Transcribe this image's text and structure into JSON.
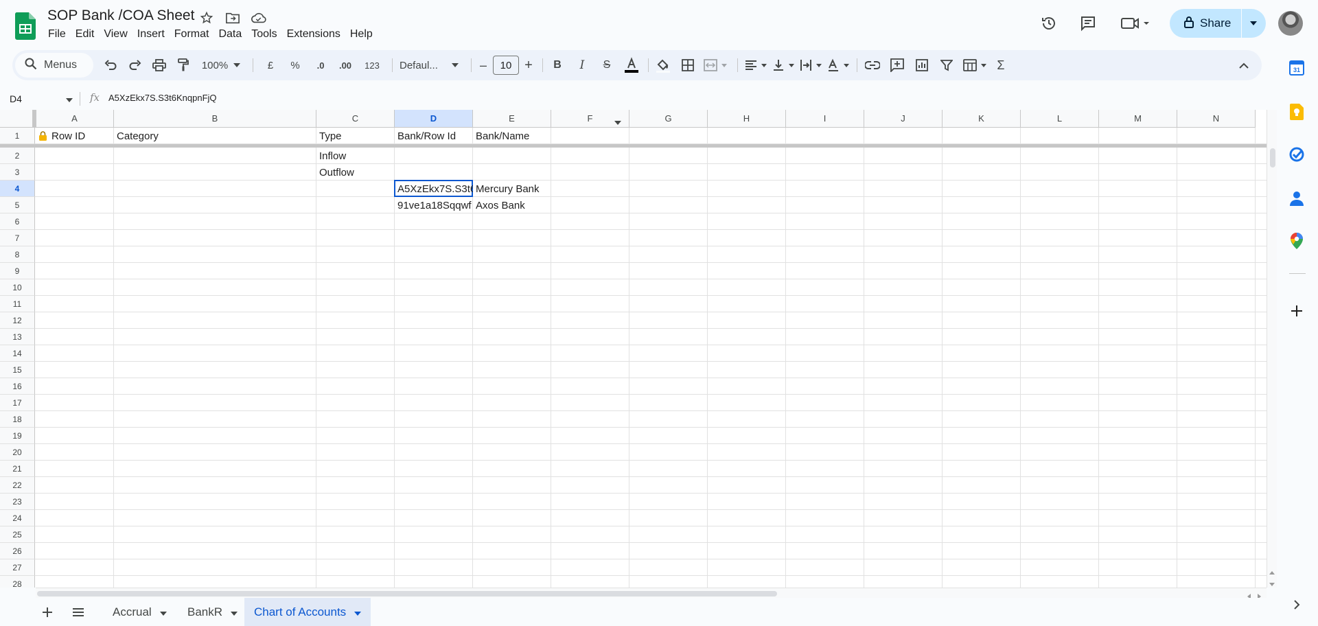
{
  "app": {
    "doc_title": "SOP Bank /COA Sheet",
    "menu": [
      "File",
      "Edit",
      "View",
      "Insert",
      "Format",
      "Data",
      "Tools",
      "Extensions",
      "Help"
    ],
    "share_label": "Share"
  },
  "toolbar": {
    "menus_label": "Menus",
    "zoom": "100%",
    "currency_symbol": "£",
    "percent_symbol": "%",
    "decrease_decimal": ".0",
    "increase_decimal": ".00",
    "number_format": "123",
    "font_name": "Defaul...",
    "font_size": "10",
    "minus": "–",
    "plus": "+"
  },
  "formula_bar": {
    "name_box": "D4",
    "fx": "fx",
    "value": "A5XzEkx7S.S3t6KnqpnFjQ"
  },
  "columns": [
    "A",
    "B",
    "C",
    "D",
    "E",
    "F",
    "G",
    "H",
    "I",
    "J",
    "K",
    "L",
    "M",
    "N"
  ],
  "rows": [
    "1",
    "2",
    "3",
    "4",
    "5",
    "6",
    "7",
    "8",
    "9",
    "10",
    "11",
    "12",
    "13",
    "14",
    "15",
    "16",
    "17",
    "18",
    "19",
    "20",
    "21",
    "22",
    "23",
    "24",
    "25",
    "26",
    "27",
    "28"
  ],
  "header_row": {
    "a": "Row ID",
    "b": "Category",
    "c": "Type",
    "d": "Bank/Row Id",
    "e": "Bank/Name"
  },
  "cells": {
    "c2": "Inflow",
    "c3": "Outflow",
    "d4": "A5XzEkx7S.S3t6KnqpnFjQ",
    "e4": "Mercury Bank",
    "d5": "91ve1a18Sqqwf",
    "e5": "Axos Bank"
  },
  "sheet_tabs": [
    "Accrual",
    "BankR",
    "Chart of Accounts"
  ],
  "active_tab": "Chart of Accounts",
  "selected_cell": "D4",
  "side_panel_icons": [
    "calendar-icon",
    "keep-icon",
    "tasks-icon",
    "contacts-icon",
    "maps-icon",
    "add-icon"
  ],
  "colors": {
    "accent": "#0b57d0",
    "share_bg": "#c2e7ff",
    "sheets_green": "#0f9d58"
  }
}
